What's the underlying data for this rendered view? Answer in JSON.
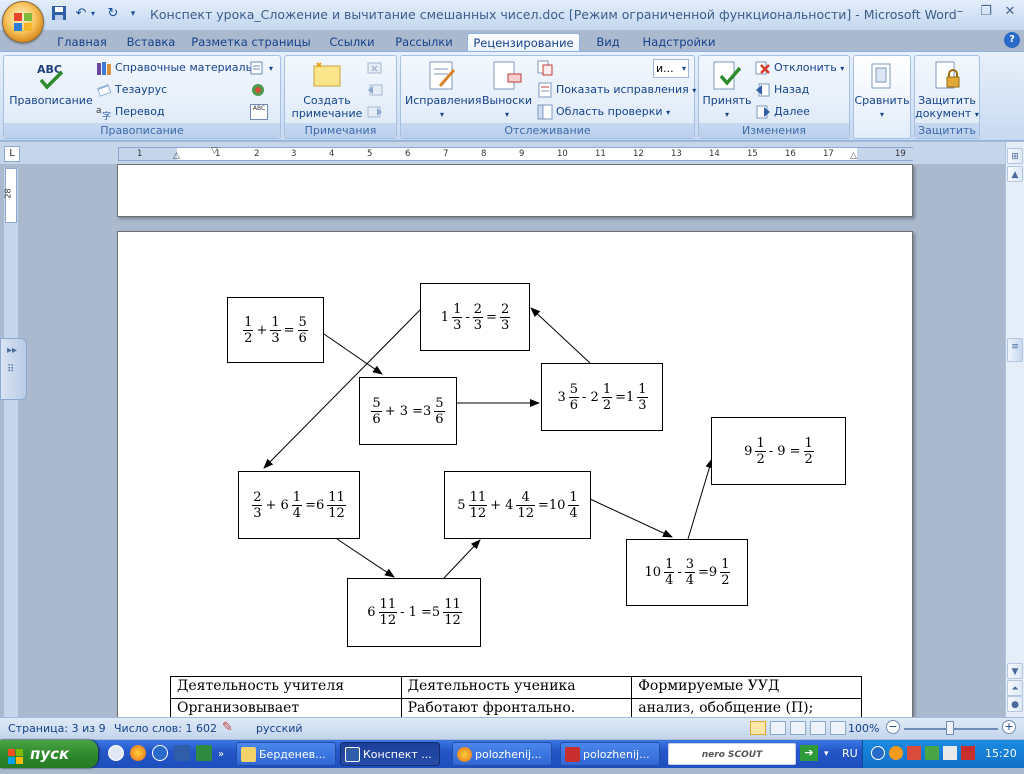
{
  "window": {
    "title": "Конспект урока_Сложение и вычитание смешанных чисел.doc [Режим ограниченной функциональности] - Microsoft Word"
  },
  "tabs": [
    "Главная",
    "Вставка",
    "Разметка страницы",
    "Ссылки",
    "Рассылки",
    "Рецензирование",
    "Вид",
    "Надстройки"
  ],
  "active_tab": "Рецензирование",
  "ribbon": {
    "spelling": {
      "label": "Правописание",
      "big_button": "Правописание",
      "ref_materials": "Справочные материалы",
      "thesaurus": "Тезаурус",
      "translate": "Перевод",
      "abc_icon_text": "ABC"
    },
    "comments": {
      "label": "Примечания",
      "create_line1": "Создать",
      "create_line2": "примечание"
    },
    "tracking": {
      "label": "Отслеживание",
      "track_changes": "Исправления",
      "balloons": "Выноски",
      "display_select": "и...",
      "show_markup": "Показать исправления",
      "review_pane": "Область проверки"
    },
    "changes": {
      "label": "Изменения",
      "accept": "Принять",
      "reject": "Отклонить",
      "previous": "Назад",
      "next": "Далее"
    },
    "compare": {
      "label": "Сравнить"
    },
    "protect": {
      "label": "Защитить",
      "protect_line1": "Защитить",
      "protect_line2": "документ"
    }
  },
  "ruler": {
    "h_marks": [
      "1",
      "1",
      "2",
      "3",
      "4",
      "5",
      "6",
      "7",
      "8",
      "9",
      "10",
      "11",
      "12",
      "13",
      "14",
      "15",
      "16",
      "17",
      "19"
    ],
    "v_mark": "28"
  },
  "diagram": {
    "boxes": [
      {
        "id": "b1",
        "parts": [
          [
            "f",
            "1",
            "2"
          ],
          [
            "t",
            "+"
          ],
          [
            "f",
            "1",
            "3"
          ],
          [
            "t",
            "="
          ],
          [
            "f",
            "5",
            "6"
          ]
        ]
      },
      {
        "id": "b2",
        "parts": [
          [
            "t",
            "1"
          ],
          [
            "f",
            "1",
            "3"
          ],
          [
            "t",
            "-"
          ],
          [
            "f",
            "2",
            "3"
          ],
          [
            "t",
            "="
          ],
          [
            "f",
            "2",
            "3"
          ]
        ]
      },
      {
        "id": "b3",
        "parts": [
          [
            "f",
            "5",
            "6"
          ],
          [
            "t",
            "+ 3 =3"
          ],
          [
            "f",
            "5",
            "6"
          ]
        ]
      },
      {
        "id": "b4",
        "parts": [
          [
            "t",
            "3"
          ],
          [
            "f",
            "5",
            "6"
          ],
          [
            "t",
            "- 2"
          ],
          [
            "f",
            "1",
            "2"
          ],
          [
            "t",
            "=1"
          ],
          [
            "f",
            "1",
            "3"
          ]
        ]
      },
      {
        "id": "b5",
        "parts": [
          [
            "t",
            "9"
          ],
          [
            "f",
            "1",
            "2"
          ],
          [
            "t",
            "- 9 ="
          ],
          [
            "f",
            "1",
            "2"
          ]
        ]
      },
      {
        "id": "b6",
        "parts": [
          [
            "f",
            "2",
            "3"
          ],
          [
            "t",
            "+ 6"
          ],
          [
            "f",
            "1",
            "4"
          ],
          [
            "t",
            "=6"
          ],
          [
            "f",
            "11",
            "12"
          ]
        ]
      },
      {
        "id": "b7",
        "parts": [
          [
            "t",
            "5"
          ],
          [
            "f",
            "11",
            "12"
          ],
          [
            "t",
            "+ 4"
          ],
          [
            "f",
            "4",
            "12"
          ],
          [
            "t",
            "=10"
          ],
          [
            "f",
            "1",
            "4"
          ]
        ]
      },
      {
        "id": "b8",
        "parts": [
          [
            "t",
            "6"
          ],
          [
            "f",
            "11",
            "12"
          ],
          [
            "t",
            "- 1 =5"
          ],
          [
            "f",
            "11",
            "12"
          ]
        ]
      },
      {
        "id": "b9",
        "parts": [
          [
            "t",
            "10"
          ],
          [
            "f",
            "1",
            "4"
          ],
          [
            "t",
            "-"
          ],
          [
            "f",
            "3",
            "4"
          ],
          [
            "t",
            "=9"
          ],
          [
            "f",
            "1",
            "2"
          ]
        ]
      }
    ]
  },
  "table": {
    "headers": [
      "Деятельность учителя",
      "Деятельность ученика",
      "Формируемые УУД"
    ],
    "row1": [
      "Организовывает",
      "Работают фронтально.",
      "анализ, обобщение (П);"
    ]
  },
  "statusbar": {
    "page": "Страница: 3 из 9",
    "words": "Число слов: 1 602",
    "lang": "русский",
    "zoom": "100%"
  },
  "taskbar": {
    "start": "пуск",
    "items": [
      "Берденев...",
      "Конспект ...",
      "polozhenij...",
      "polozhenij..."
    ],
    "nero": "nero SCOUT",
    "lang": "RU",
    "time": "15:20"
  }
}
